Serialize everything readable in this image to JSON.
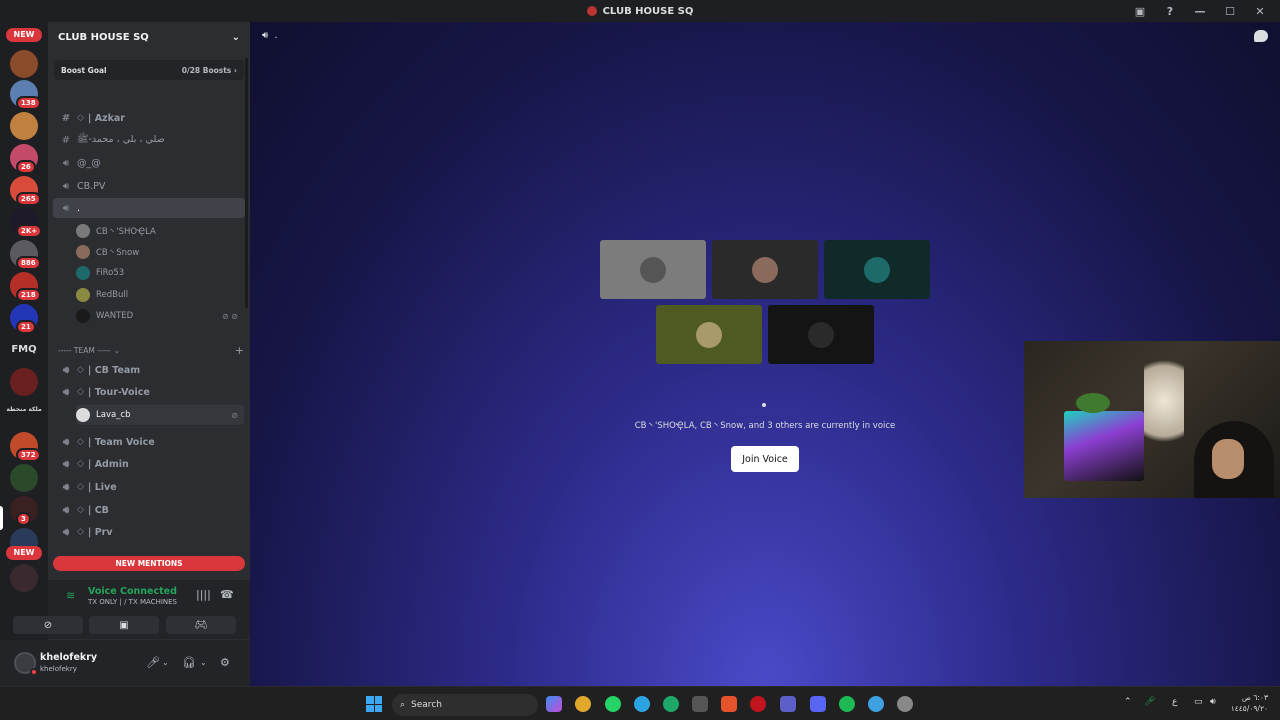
{
  "window": {
    "title": "CLUB HOUSE SQ"
  },
  "servers": {
    "new_top": "NEW",
    "badges": [
      "138",
      "26",
      "265",
      "2K+",
      "886",
      "218",
      "21",
      "372",
      "3"
    ],
    "fmq": "FMQ",
    "arabic_name": "ملكة منحطة",
    "new_bottom": "NEW"
  },
  "guild": {
    "name": "CLUB HOUSE SQ",
    "boost_label": "Boost Goal",
    "boost_count": "0/28 Boosts"
  },
  "channels": {
    "azkar": "| Azkar",
    "arabic_text": "صلي ، بلي ، محمد-ﷺ",
    "at_at": "@_@",
    "cbpv": "CB.PV",
    "dot": ".",
    "voice_users": [
      "CB丶'SHOҾLA",
      "CB丶Snow",
      "FiRo53",
      "RedBull",
      "WANTED"
    ],
    "team_category": "----- TEAM -----",
    "cb_team": "| CB Team",
    "tour_voice": "| Tour-Voice",
    "lava_user": "Lava_cb",
    "team_voice": "| Team Voice",
    "admin": "| Admin",
    "live": "| Live",
    "cb": "| CB",
    "prv": "| Prv"
  },
  "new_mentions": "NEW MENTIONS",
  "voice": {
    "status": "Voice Connected",
    "channel": "TX ONLY | / TX MACHINES"
  },
  "user": {
    "name": "khelofekry",
    "tag": "khelofekry"
  },
  "main": {
    "channel_name": ".",
    "status_text": "CB丶'SHOҾLA, CB丶Snow, and 3 others are currently in voice",
    "join_label": "Join Voice"
  },
  "taskbar": {
    "search_label": "Search",
    "tray_lang": "ع",
    "clock_time": "٦:٠٣ ص",
    "clock_date": "١٤٤٥/٠٩/٢٠"
  },
  "colors": {
    "accent_red": "#da373c",
    "voice_green": "#23a55a",
    "blurple": "#4b49c8"
  }
}
